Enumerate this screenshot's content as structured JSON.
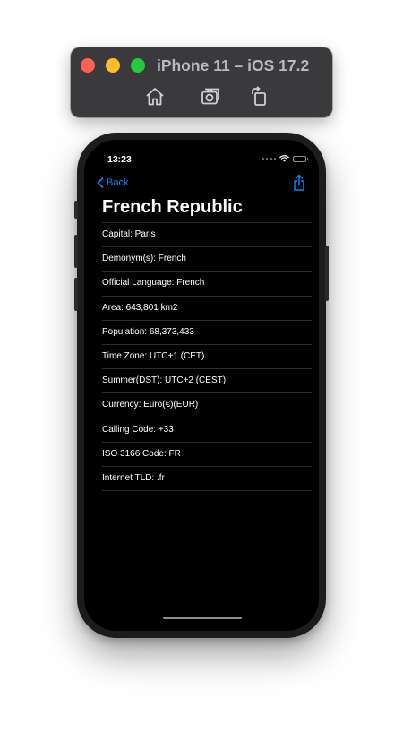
{
  "simulator": {
    "title": "iPhone 11 – iOS 17.2",
    "toolbar": [
      "home-icon",
      "screenshot-icon",
      "rotate-icon"
    ]
  },
  "status_bar": {
    "time": "13:23"
  },
  "nav": {
    "back_label": "Back",
    "share_icon": "share-icon"
  },
  "page_title": "French Republic",
  "rows": [
    "Capital: Paris",
    "Demonym(s): French",
    "Official Language: French",
    "Area: 643,801 km2",
    "Population: 68,373,433",
    "Time Zone: UTC+1 (CET)",
    "Summer(DST): UTC+2 (CEST)",
    "Currency: Euro(€)(EUR)",
    "Calling Code: +33",
    "ISO 3166 Code: FR",
    "Internet TLD: .fr"
  ],
  "colors": {
    "accent": "#0a84ff",
    "screen_bg": "#000000",
    "separator": "#2c2c2e",
    "window_bar": "#3a3a3c"
  }
}
